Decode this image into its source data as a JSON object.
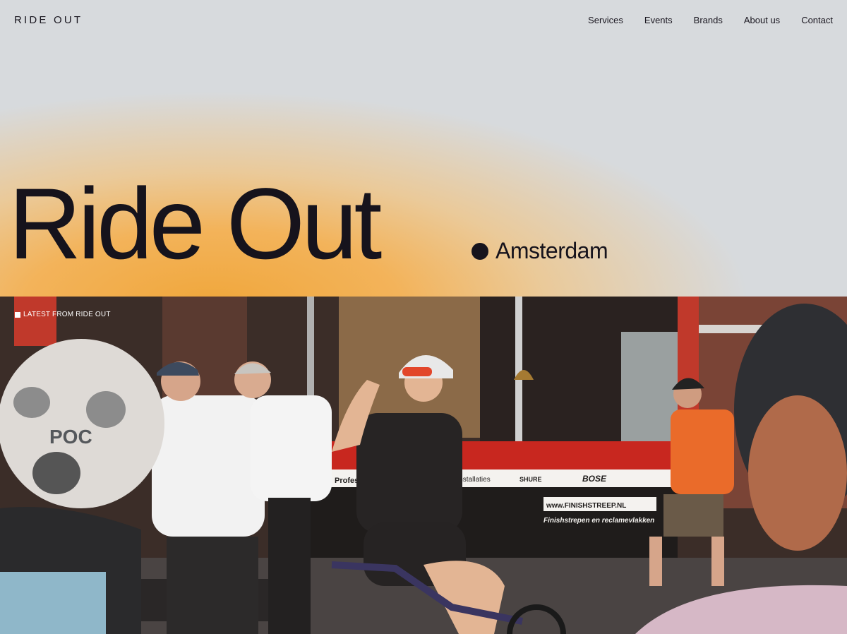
{
  "header": {
    "logo": "RIDE OUT",
    "nav": [
      "Services",
      "Events",
      "Brands",
      "About us",
      "Contact"
    ]
  },
  "hero": {
    "title": "Ride Out",
    "location": "Amsterdam"
  },
  "feature": {
    "label": "LATEST FROM RIDE OUT",
    "photo_signage": {
      "sign_professional": "Professiona",
      "sign_installaties": "installaties",
      "sign_shure": "SHURE",
      "sign_bose": "BOSE",
      "sign_url": "www.FINISHSTREEP.NL",
      "sign_slogan": "Finishstrepen en reclamevlakken",
      "helmet_brand": "POC"
    }
  },
  "colors": {
    "background": "#d7dadd",
    "accent_gradient": "#f0a73c",
    "text": "#16131c"
  }
}
